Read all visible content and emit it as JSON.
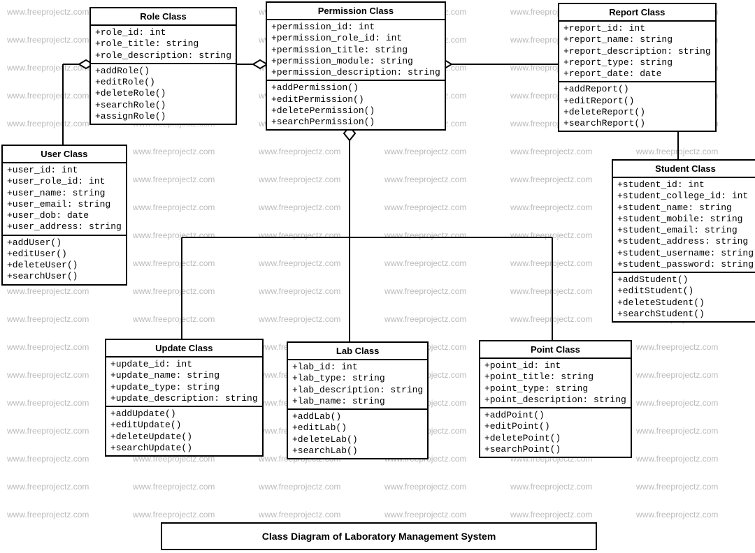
{
  "chart_data": {
    "type": "uml-class-diagram",
    "title": "Class Diagram of Laboratory Management System",
    "classes": [
      {
        "name": "Role Class",
        "attributes": [
          "+role_id: int",
          "+role_title: string",
          "+role_description: string"
        ],
        "methods": [
          "+addRole()",
          "+editRole()",
          "+deleteRole()",
          "+searchRole()",
          "+assignRole()"
        ]
      },
      {
        "name": "Permission Class",
        "attributes": [
          "+permission_id: int",
          "+permission_role_id: int",
          "+permission_title: string",
          "+permission_module: string",
          "+permission_description: string"
        ],
        "methods": [
          "+addPermission()",
          "+editPermission()",
          "+deletePermission()",
          "+searchPermission()"
        ]
      },
      {
        "name": "Report Class",
        "attributes": [
          "+report_id: int",
          "+report_name: string",
          "+report_description: string",
          "+report_type: string",
          "+report_date: date"
        ],
        "methods": [
          "+addReport()",
          "+editReport()",
          "+deleteReport()",
          "+searchReport()"
        ]
      },
      {
        "name": "User Class",
        "attributes": [
          "+user_id: int",
          "+user_role_id: int",
          "+user_name: string",
          "+user_email: string",
          "+user_dob: date",
          "+user_address: string"
        ],
        "methods": [
          "+addUser()",
          "+editUser()",
          "+deleteUser()",
          "+searchUser()"
        ]
      },
      {
        "name": "Student Class",
        "attributes": [
          "+student_id: int",
          "+student_college_id: int",
          "+student_name: string",
          "+student_mobile: string",
          "+student_email: string",
          "+student_address: string",
          "+student_username: string",
          "+student_password: string"
        ],
        "methods": [
          "+addStudent()",
          "+editStudent()",
          "+deleteStudent()",
          "+searchStudent()"
        ]
      },
      {
        "name": "Update Class",
        "attributes": [
          "+update_id: int",
          "+update_name: string",
          "+update_type: string",
          "+update_description: string"
        ],
        "methods": [
          "+addUpdate()",
          "+editUpdate()",
          "+deleteUpdate()",
          "+searchUpdate()"
        ]
      },
      {
        "name": "Lab Class",
        "attributes": [
          "+lab_id: int",
          "+lab_type: string",
          "+lab_description: string",
          "+lab_name: string"
        ],
        "methods": [
          "+addLab()",
          "+editLab()",
          "+deleteLab()",
          "+searchLab()"
        ]
      },
      {
        "name": "Point Class",
        "attributes": [
          "+point_id: int",
          "+point_title: string",
          "+point_type: string",
          "+point_description: string"
        ],
        "methods": [
          "+addPoint()",
          "+editPoint()",
          "+deletePoint()",
          "+searchPoint()"
        ]
      }
    ],
    "relationships": [
      {
        "from": "User Class",
        "to": "Role Class",
        "type": "aggregation"
      },
      {
        "from": "Role Class",
        "to": "Permission Class",
        "type": "aggregation"
      },
      {
        "from": "Report Class",
        "to": "Permission Class",
        "type": "aggregation"
      },
      {
        "from": "Update Class",
        "to": "Permission Class",
        "type": "aggregation-via"
      },
      {
        "from": "Lab Class",
        "to": "Permission Class",
        "type": "aggregation-via"
      },
      {
        "from": "Point Class",
        "to": "Permission Class",
        "type": "aggregation-via"
      },
      {
        "from": "Student Class",
        "to": "Report Class",
        "type": "association"
      }
    ]
  },
  "watermark_text": "www.freeprojectz.com",
  "title": "Class Diagram of Laboratory Management System",
  "role": {
    "title": "Role Class",
    "a0": "+role_id: int",
    "a1": "+role_title: string",
    "a2": "+role_description: string",
    "m0": "+addRole()",
    "m1": "+editRole()",
    "m2": "+deleteRole()",
    "m3": "+searchRole()",
    "m4": "+assignRole()"
  },
  "permission": {
    "title": "Permission Class",
    "a0": "+permission_id: int",
    "a1": "+permission_role_id: int",
    "a2": "+permission_title: string",
    "a3": "+permission_module: string",
    "a4": "+permission_description: string",
    "m0": "+addPermission()",
    "m1": "+editPermission()",
    "m2": "+deletePermission()",
    "m3": "+searchPermission()"
  },
  "report": {
    "title": "Report Class",
    "a0": "+report_id: int",
    "a1": "+report_name: string",
    "a2": "+report_description: string",
    "a3": "+report_type: string",
    "a4": "+report_date: date",
    "m0": "+addReport()",
    "m1": "+editReport()",
    "m2": "+deleteReport()",
    "m3": "+searchReport()"
  },
  "user": {
    "title": "User Class",
    "a0": "+user_id: int",
    "a1": "+user_role_id: int",
    "a2": "+user_name: string",
    "a3": "+user_email: string",
    "a4": "+user_dob: date",
    "a5": "+user_address: string",
    "m0": "+addUser()",
    "m1": "+editUser()",
    "m2": "+deleteUser()",
    "m3": "+searchUser()"
  },
  "student": {
    "title": "Student Class",
    "a0": "+student_id: int",
    "a1": "+student_college_id: int",
    "a2": "+student_name: string",
    "a3": "+student_mobile: string",
    "a4": "+student_email: string",
    "a5": "+student_address: string",
    "a6": "+student_username: string",
    "a7": "+student_password: string",
    "m0": "+addStudent()",
    "m1": "+editStudent()",
    "m2": "+deleteStudent()",
    "m3": "+searchStudent()"
  },
  "update": {
    "title": "Update Class",
    "a0": "+update_id: int",
    "a1": "+update_name: string",
    "a2": "+update_type: string",
    "a3": "+update_description: string",
    "m0": "+addUpdate()",
    "m1": "+editUpdate()",
    "m2": "+deleteUpdate()",
    "m3": "+searchUpdate()"
  },
  "lab": {
    "title": "Lab Class",
    "a0": "+lab_id: int",
    "a1": "+lab_type: string",
    "a2": "+lab_description: string",
    "a3": "+lab_name: string",
    "m0": "+addLab()",
    "m1": "+editLab()",
    "m2": "+deleteLab()",
    "m3": "+searchLab()"
  },
  "point": {
    "title": "Point Class",
    "a0": "+point_id: int",
    "a1": "+point_title: string",
    "a2": "+point_type: string",
    "a3": "+point_description: string",
    "m0": "+addPoint()",
    "m1": "+editPoint()",
    "m2": "+deletePoint()",
    "m3": "+searchPoint()"
  }
}
